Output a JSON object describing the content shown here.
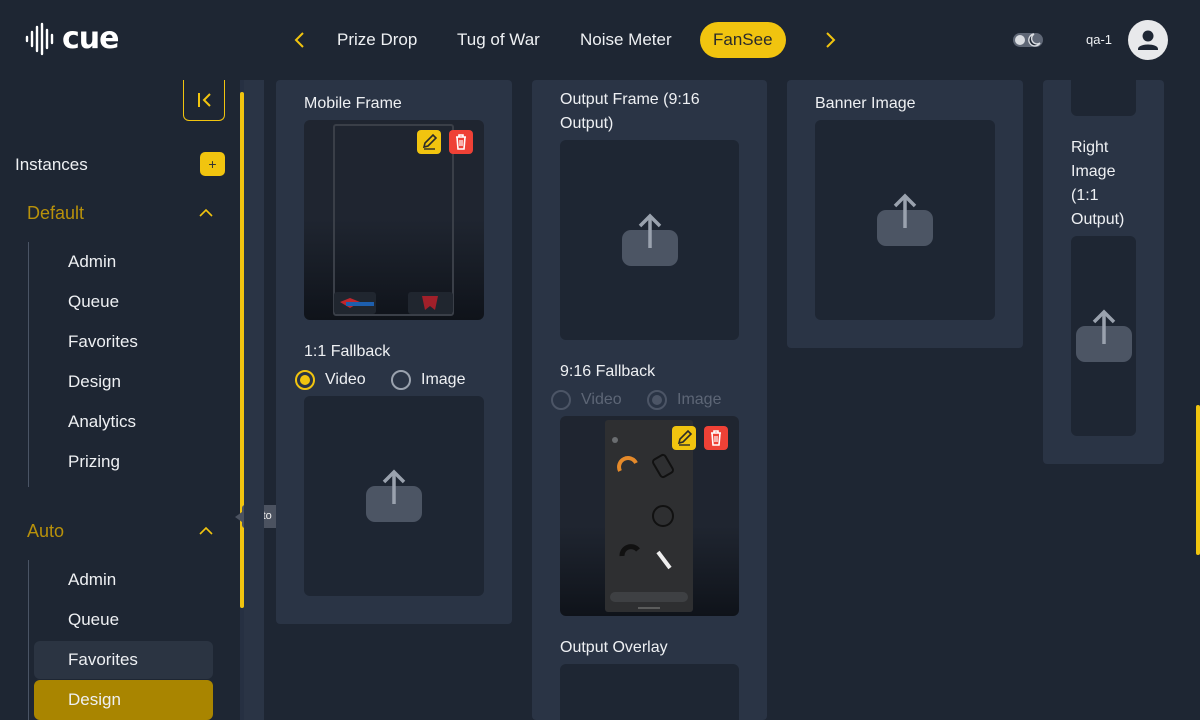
{
  "brand": {
    "name": "cue"
  },
  "nav": {
    "tabs": [
      {
        "label": "Prize Drop",
        "active": false
      },
      {
        "label": "Tug of War",
        "active": false
      },
      {
        "label": "Noise Meter",
        "active": false
      },
      {
        "label": "FanSee",
        "active": true
      }
    ],
    "prev_icon": "chevron-left-icon",
    "next_icon": "chevron-right-icon"
  },
  "header": {
    "username": "qa-1",
    "theme_icon": "theme-toggle-icon",
    "avatar_icon": "user-icon"
  },
  "sidebar": {
    "instances_label": "Instances",
    "add_label": "+",
    "tooltip": "Auto",
    "groups": [
      {
        "label": "Default",
        "items": [
          "Admin",
          "Queue",
          "Favorites",
          "Design",
          "Analytics",
          "Prizing"
        ]
      },
      {
        "label": "Auto",
        "items": [
          "Admin",
          "Queue",
          "Favorites",
          "Design"
        ],
        "hovered": "Favorites",
        "active": "Design"
      }
    ]
  },
  "fields": {
    "mobile_frame": "Mobile Frame",
    "fallback_1_1": "1:1 Fallback",
    "fallback_1_1_options": [
      "Video",
      "Image"
    ],
    "fallback_1_1_selected": "Video",
    "output_frame": "Output Frame (9:16 Output)",
    "fallback_9_16": "9:16 Fallback",
    "fallback_9_16_options": [
      "Video",
      "Image"
    ],
    "fallback_9_16_selected": "Image",
    "output_overlay": "Output Overlay",
    "banner_image": "Banner Image",
    "right_image": "Right Image (1:1 Output)"
  },
  "colors": {
    "accent": "#f1c40f",
    "background": "#1e2633",
    "card": "#2a3445",
    "danger": "#ef4136",
    "active_item": "#a98500"
  }
}
